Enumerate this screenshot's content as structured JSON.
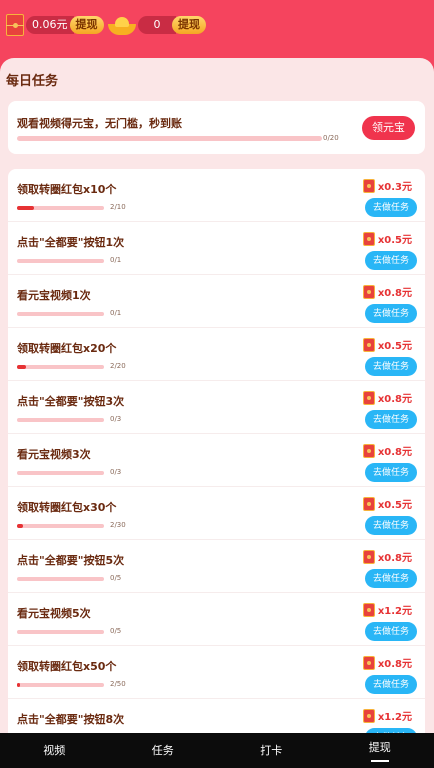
{
  "header": {
    "redpack_value": "0.06元",
    "redpack_withdraw": "提现",
    "yuanbao_value": "0",
    "yuanbao_withdraw": "提现"
  },
  "daily": {
    "title": "每日任务",
    "watch": {
      "label": "观看视频得元宝，无门槛，秒到账",
      "progress": "0/20",
      "button": "领元宝"
    }
  },
  "tasks": [
    {
      "name": "领取转圈红包x10个",
      "progress": "2/10",
      "fraction": 0.2,
      "reward": "x0.3元",
      "button": "去做任务"
    },
    {
      "name": "点击\"全都要\"按钮1次",
      "progress": "0/1",
      "fraction": 0,
      "reward": "x0.5元",
      "button": "去做任务"
    },
    {
      "name": "看元宝视频1次",
      "progress": "0/1",
      "fraction": 0,
      "reward": "x0.8元",
      "button": "去做任务"
    },
    {
      "name": "领取转圈红包x20个",
      "progress": "2/20",
      "fraction": 0.1,
      "reward": "x0.5元",
      "button": "去做任务"
    },
    {
      "name": "点击\"全都要\"按钮3次",
      "progress": "0/3",
      "fraction": 0,
      "reward": "x0.8元",
      "button": "去做任务"
    },
    {
      "name": "看元宝视频3次",
      "progress": "0/3",
      "fraction": 0,
      "reward": "x0.8元",
      "button": "去做任务"
    },
    {
      "name": "领取转圈红包x30个",
      "progress": "2/30",
      "fraction": 0.0667,
      "reward": "x0.5元",
      "button": "去做任务"
    },
    {
      "name": "点击\"全都要\"按钮5次",
      "progress": "0/5",
      "fraction": 0,
      "reward": "x0.8元",
      "button": "去做任务"
    },
    {
      "name": "看元宝视频5次",
      "progress": "0/5",
      "fraction": 0,
      "reward": "x1.2元",
      "button": "去做任务"
    },
    {
      "name": "领取转圈红包x50个",
      "progress": "2/50",
      "fraction": 0.04,
      "reward": "x0.8元",
      "button": "去做任务"
    },
    {
      "name": "点击\"全都要\"按钮8次",
      "progress": "",
      "fraction": 0,
      "reward": "x1.2元",
      "button": "去做任务"
    }
  ],
  "nav": [
    {
      "label": "视频",
      "active": false
    },
    {
      "label": "任务",
      "active": false
    },
    {
      "label": "打卡",
      "active": false
    },
    {
      "label": "提现",
      "active": true
    }
  ],
  "colors": {
    "header_bg": "#f5445e",
    "panel_bg": "#fbe6e7",
    "accent_red": "#e63234",
    "button_blue": "#29b6f6"
  }
}
